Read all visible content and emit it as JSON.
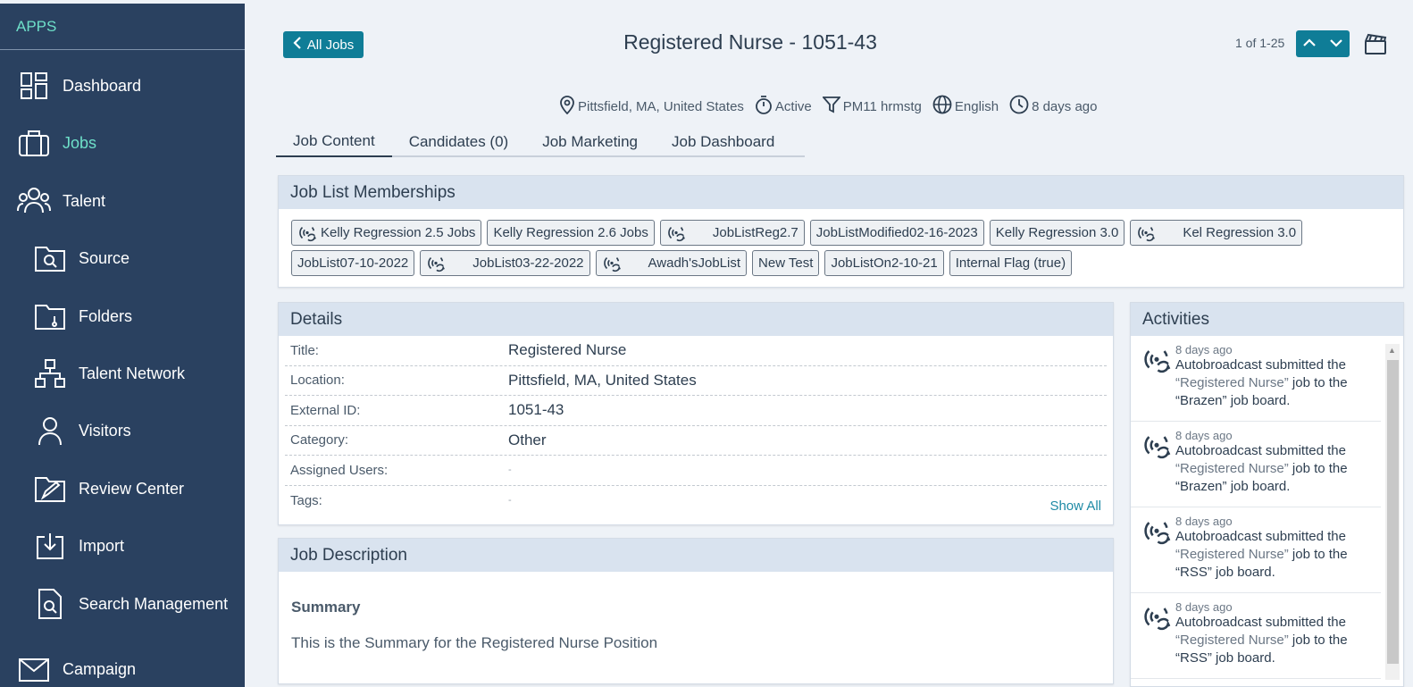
{
  "sidebar": {
    "apps_label": "APPS",
    "items": [
      {
        "label": "Dashboard",
        "icon": "dashboard-icon"
      },
      {
        "label": "Jobs",
        "icon": "briefcase-icon"
      },
      {
        "label": "Talent",
        "icon": "people-icon"
      },
      {
        "label": "Source",
        "icon": "folder-search-icon"
      },
      {
        "label": "Folders",
        "icon": "folder-icon"
      },
      {
        "label": "Talent Network",
        "icon": "network-icon"
      },
      {
        "label": "Visitors",
        "icon": "person-icon"
      },
      {
        "label": "Review Center",
        "icon": "review-folder-icon"
      },
      {
        "label": "Import",
        "icon": "import-icon"
      },
      {
        "label": "Search Management",
        "icon": "search-doc-icon"
      },
      {
        "label": "Campaign",
        "icon": "mail-icon"
      }
    ]
  },
  "header": {
    "back_label": "All Jobs",
    "title": "Registered Nurse - 1051-43",
    "pager_text": "1 of 1-25"
  },
  "meta": {
    "location": "Pittsfield, MA, United States",
    "status": "Active",
    "owner": "PM11 hrmstg",
    "language": "English",
    "age": "8 days ago"
  },
  "tabs": [
    "Job Content",
    "Candidates (0)",
    "Job Marketing",
    "Job Dashboard"
  ],
  "memberships": {
    "title": "Job List Memberships",
    "chips": [
      {
        "label": "Kelly Regression 2.5 Jobs",
        "broadcast": true
      },
      {
        "label": "Kelly Regression 2.6 Jobs",
        "broadcast": false
      },
      {
        "label": "JobListReg2.7",
        "broadcast": true
      },
      {
        "label": "JobListModified02-16-2023",
        "broadcast": false
      },
      {
        "label": "Kelly Regression 3.0",
        "broadcast": false
      },
      {
        "label": "Kel Regression 3.0",
        "broadcast": true
      },
      {
        "label": "JobList07-10-2022",
        "broadcast": false
      },
      {
        "label": "JobList03-22-2022",
        "broadcast": true
      },
      {
        "label": "Awadh'sJobList",
        "broadcast": true
      },
      {
        "label": "New Test",
        "broadcast": false
      },
      {
        "label": "JobListOn2-10-21",
        "broadcast": false
      },
      {
        "label": "Internal Flag (true)",
        "broadcast": false
      }
    ]
  },
  "details": {
    "title": "Details",
    "rows": [
      {
        "label": "Title:",
        "value": "Registered Nurse"
      },
      {
        "label": "Location:",
        "value": "Pittsfield, MA, United States"
      },
      {
        "label": "External ID:",
        "value": "1051-43"
      },
      {
        "label": "Category:",
        "value": "Other"
      },
      {
        "label": "Assigned Users:",
        "value": "-"
      },
      {
        "label": "Tags:",
        "value": "-"
      }
    ],
    "show_all": "Show All"
  },
  "job_description": {
    "title": "Job Description",
    "summary_title": "Summary",
    "summary_text": "This is the Summary for the Registered Nurse Position"
  },
  "activities": {
    "title": "Activities",
    "items": [
      {
        "time": "8 days ago",
        "prefix": "Autobroadcast submitted the",
        "job": "“Registered Nurse”",
        "mid": "job to the",
        "board": "“Brazen”",
        "suffix": "job board."
      },
      {
        "time": "8 days ago",
        "prefix": "Autobroadcast submitted the",
        "job": "“Registered Nurse”",
        "mid": "job to the",
        "board": "“Brazen”",
        "suffix": "job board."
      },
      {
        "time": "8 days ago",
        "prefix": "Autobroadcast submitted the",
        "job": "“Registered Nurse”",
        "mid": "job to the",
        "board": "“RSS”",
        "suffix": "job board."
      },
      {
        "time": "8 days ago",
        "prefix": "Autobroadcast submitted the",
        "job": "“Registered Nurse”",
        "mid": "job to the",
        "board": "“RSS”",
        "suffix": "job board."
      }
    ]
  },
  "colors": {
    "sidebar_bg": "#2a4160",
    "accent": "#0f7d97",
    "active_nav": "#6ee0c9",
    "panel_head": "#d9e3ef"
  }
}
